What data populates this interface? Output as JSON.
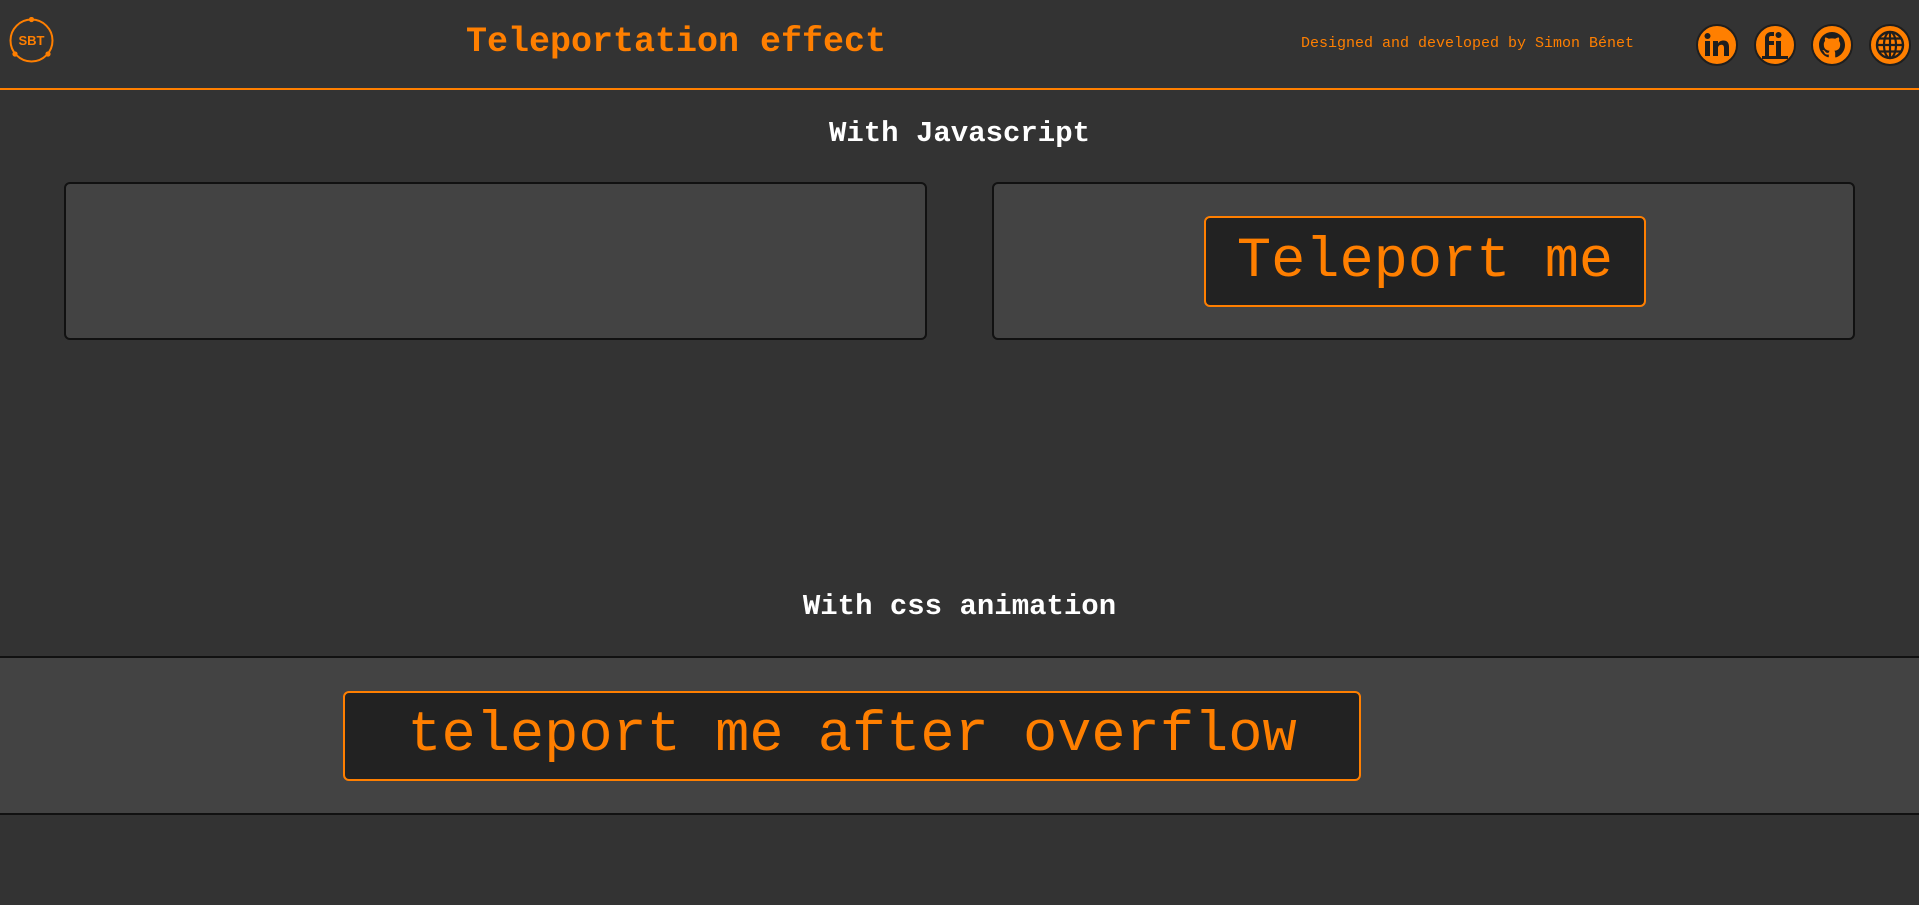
{
  "header": {
    "logo_text": "SBT",
    "title": "Teleportation effect",
    "credit": "Designed and developed by Simon Bénet",
    "social": [
      {
        "icon": "linkedin-icon",
        "name": "linkedin-link"
      },
      {
        "icon": "freelance-icon",
        "name": "freelance-link"
      },
      {
        "icon": "github-icon",
        "name": "github-link"
      },
      {
        "icon": "globe-icon",
        "name": "website-link"
      }
    ]
  },
  "sections": {
    "javascript": {
      "title": "With Javascript",
      "button_label": "Teleport me"
    },
    "css": {
      "title": "With css animation",
      "button_label": "teleport me after overflow"
    }
  },
  "colors": {
    "accent": "#ff7f00",
    "background": "#333333",
    "panel": "#434343",
    "button_bg": "#222222"
  }
}
